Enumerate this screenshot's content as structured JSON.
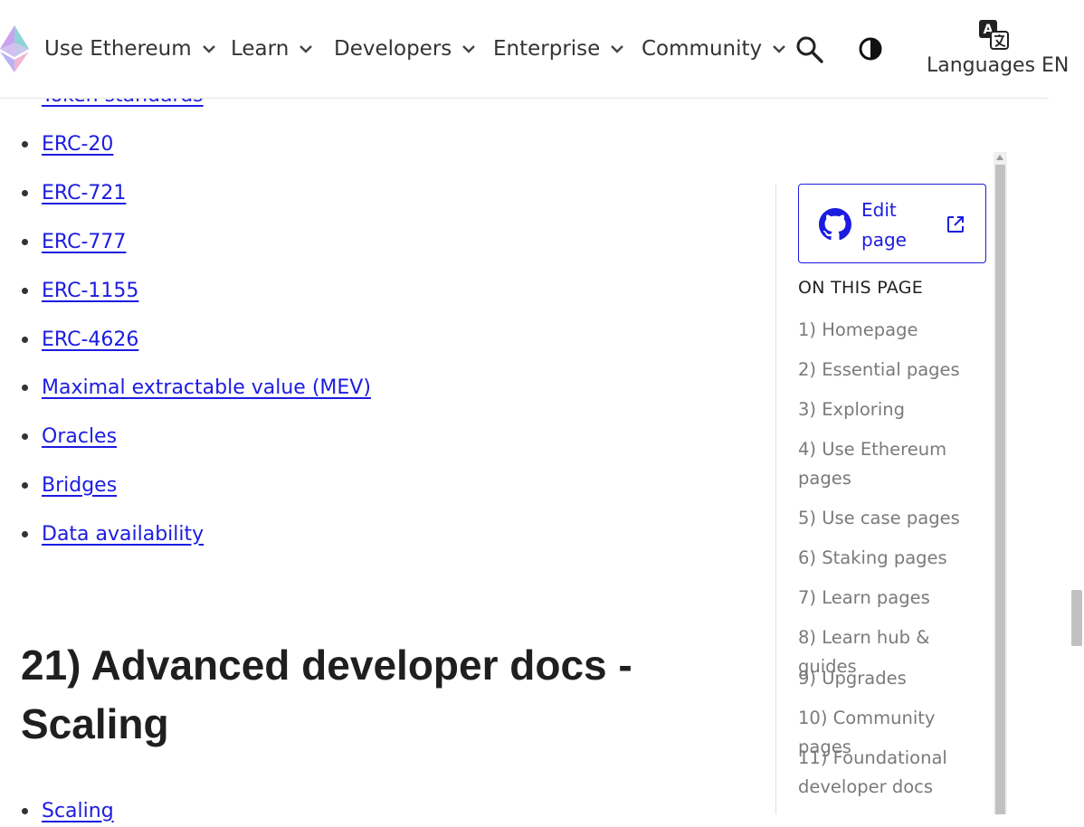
{
  "nav": {
    "items": [
      {
        "label": "Use Ethereum"
      },
      {
        "label": "Learn"
      },
      {
        "label": "Developers"
      },
      {
        "label": "Enterprise"
      },
      {
        "label": "Community"
      }
    ],
    "languages_label": "Languages EN",
    "icons": [
      "ethereum-logo",
      "chevron-down-icon",
      "search-icon",
      "theme-toggle-icon",
      "translate-icon"
    ]
  },
  "content": {
    "links": [
      {
        "label": "Token standards"
      },
      {
        "label": "ERC-20"
      },
      {
        "label": "ERC-721"
      },
      {
        "label": "ERC-777"
      },
      {
        "label": "ERC-1155"
      },
      {
        "label": "ERC-4626"
      },
      {
        "label": "Maximal extractable value (MEV)"
      },
      {
        "label": "Oracles"
      },
      {
        "label": "Bridges"
      },
      {
        "label": "Data availability"
      }
    ],
    "heading": "21) Advanced developer docs - Scaling",
    "next_link": "Scaling"
  },
  "sidebar": {
    "edit_label": "Edit page",
    "toc_title": "ON THIS PAGE",
    "toc": [
      "1) Homepage",
      "2) Essential pages",
      "3) Exploring",
      "4) Use Ethereum pages",
      "5) Use case pages",
      "6) Staking pages",
      "7) Learn pages",
      "8) Learn hub & guides",
      "9) Upgrades",
      "10) Community pages",
      "11) Foundational developer docs"
    ]
  },
  "colors": {
    "link": "#1c1ce1",
    "toc_text": "#7a7a7a",
    "heading": "#1f1f1f"
  }
}
